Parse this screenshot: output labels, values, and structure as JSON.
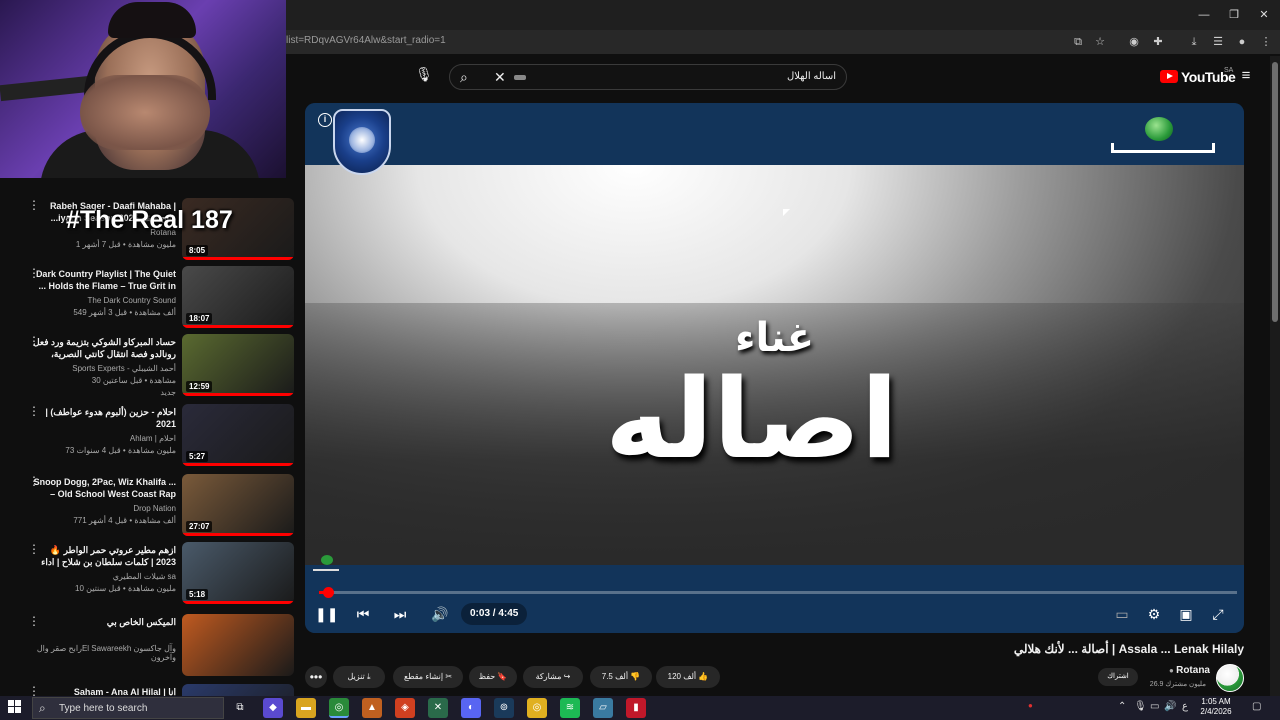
{
  "browser": {
    "url": "list=RDqvAGVr64Alw&start_radio=1"
  },
  "youtube": {
    "logo_text": "YouTube",
    "region": "SA",
    "search_query": "اساله الهلال"
  },
  "webcam": {
    "overlay_text": "#The Real 187"
  },
  "recommendations": [
    {
      "title": "Rabeh Saqer - Daafi Mahaba | ...iyadh Season 2025 رابح صقر",
      "channel": "Rotana",
      "meta": "1 مليون مشاهدة • قبل 7 أشهر",
      "duration": "8:05",
      "thumb_color": "#3a2a22",
      "extra": ""
    },
    {
      "title": "Dark Country Playlist | The Quiet ... Holds the Flame – True Grit in",
      "channel": "The Dark Country Sound",
      "meta": "549 ألف مشاهدة • قبل 3 أشهر",
      "duration": "18:07",
      "thumb_color": "#4a4a4a",
      "extra": ""
    },
    {
      "title": "حساد المبركاو الشوكي بتزيمة ورد فعل رونالدو فصة انتقال كانتي النصرية، دوربشالت...",
      "channel": "Sports Experts - أحمد الشيبلي",
      "meta": "30 مشاهدة • قبل ساعتين",
      "duration": "12:59",
      "thumb_color": "#5a6a30",
      "extra": "جديد"
    },
    {
      "title": "احلام - حزين (ألبوم هدوء عواطف) | 2021",
      "channel": "Ahlam | احلام",
      "meta": "73 مليون مشاهدة • قبل 4 سنوات",
      "duration": "5:27",
      "thumb_color": "#2a2a3a",
      "extra": ""
    },
    {
      "title": "Snoop Dogg, 2Pac, Wiz Khalifa ... – Old School West Coast Rap",
      "channel": "Drop Nation",
      "meta": "771 ألف مشاهدة • قبل 4 أشهر",
      "duration": "27:07",
      "thumb_color": "#7a5a3a",
      "extra": ""
    },
    {
      "title": "ازهم مطير عروتي حمر الواطر 🔥 2023 | كلمات سلطان بن شلاح | اداء حمود ...",
      "channel": "شيلات المطيري sa",
      "meta": "10 مليون مشاهدة • قبل سنتين",
      "duration": "5:18",
      "thumb_color": "#4a5a6a",
      "extra": ""
    },
    {
      "title": "الميكس الخاص بي",
      "channel": "رابح صقر والEl Sawareekh وآل جاكسون وآخرون",
      "meta": "",
      "duration": "",
      "thumb_color": "#c05a20",
      "extra": ""
    },
    {
      "title": "Saham - Ana Al Hilal | انا",
      "channel": "",
      "meta": "",
      "duration": "",
      "thumb_color": "#2a3a6a",
      "extra": ""
    }
  ],
  "player": {
    "title_small": "غناء",
    "title_big": "اصاله",
    "current_time": "0:03 / 4:45",
    "progress_fraction": 0.01
  },
  "video": {
    "title": "أصالة ... لأنك هلالي | Assala ... Lenak Hilaly",
    "channel_name": "Rotana",
    "channel_subs": "26.9 مليون مشترك",
    "subscribe_label": "اشتراك",
    "likes": "120 ألف",
    "dislikes": "7.5 ألف",
    "share_label": "مشاركة",
    "save_label": "حفظ",
    "clip_label": "إنشاء مقطع",
    "download_label": "تنزيل"
  },
  "taskbar": {
    "search_placeholder": "Type here to search",
    "time": "1:05 AM",
    "date": "2/4/2026",
    "lang": "ع"
  }
}
